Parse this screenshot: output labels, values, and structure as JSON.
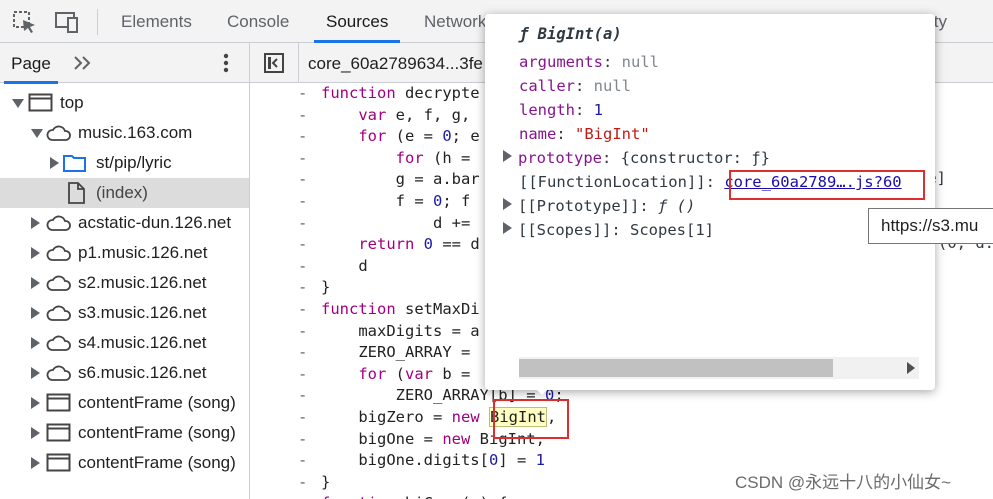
{
  "toolbar": {
    "tabs": [
      {
        "label": "Elements"
      },
      {
        "label": "Console"
      },
      {
        "label": "Sources"
      },
      {
        "label": "Network"
      },
      {
        "label": "ity"
      }
    ],
    "active_tab": "Sources"
  },
  "sidebar": {
    "tab_label": "Page",
    "tree": [
      {
        "label": "top",
        "icon": "frame-icon"
      },
      {
        "label": "music.163.com",
        "icon": "cloud-icon"
      },
      {
        "label": "st/pip/lyric",
        "icon": "folder-icon"
      },
      {
        "label": "(index)",
        "icon": "file-icon"
      },
      {
        "label": "acstatic-dun.126.net",
        "icon": "cloud-icon"
      },
      {
        "label": "p1.music.126.net",
        "icon": "cloud-icon"
      },
      {
        "label": "s2.music.126.net",
        "icon": "cloud-icon"
      },
      {
        "label": "s3.music.126.net",
        "icon": "cloud-icon"
      },
      {
        "label": "s4.music.126.net",
        "icon": "cloud-icon"
      },
      {
        "label": "s6.music.126.net",
        "icon": "cloud-icon"
      },
      {
        "label": "contentFrame (song)",
        "icon": "frame-icon"
      },
      {
        "label": "contentFrame (song)",
        "icon": "frame-icon"
      },
      {
        "label": "contentFrame (song)",
        "icon": "frame-icon"
      }
    ]
  },
  "editor": {
    "file_tab": "core_60a2789634...3fe",
    "lines": [
      {
        "gutter": "-",
        "text": "function decrypte"
      },
      {
        "gutter": "-",
        "text": "    var e, f, g,"
      },
      {
        "gutter": "-",
        "text": "    for (e = 0; e"
      },
      {
        "gutter": "-",
        "text": "        for (h ="
      },
      {
        "gutter": "-",
        "text": "        g = a.bar"
      },
      {
        "gutter": "-",
        "text": "        f = 0; f"
      },
      {
        "gutter": "-",
        "text": "            d +="
      },
      {
        "gutter": "-",
        "text": "    return 0 == d"
      },
      {
        "gutter": "-",
        "text": "    d"
      },
      {
        "gutter": "-",
        "text": "}"
      },
      {
        "gutter": "-",
        "text": "function setMaxDi"
      },
      {
        "gutter": "-",
        "text": "    maxDigits = a"
      },
      {
        "gutter": "-",
        "text": "    ZERO_ARRAY ="
      },
      {
        "gutter": "-",
        "text": "    for (var b ="
      },
      {
        "gutter": "-",
        "text": "        ZERO_ARRAY[b] = 0;"
      },
      {
        "gutter": "-",
        "text": "    bigZero = new BigInt,"
      },
      {
        "gutter": "-",
        "text": "    bigOne = new BigInt,"
      },
      {
        "gutter": "-",
        "text": "    bigOne.digits[0] = 1"
      },
      {
        "gutter": "-",
        "text": "}"
      },
      {
        "gutter": "-",
        "text": "function biCopy(a) {"
      }
    ],
    "right_fragments": [
      {
        "text": "g(c[e]"
      },
      {
        "text": "(0, d."
      }
    ],
    "highlighted_word": "BigInt"
  },
  "popover": {
    "title": "ƒ BigInt(a)",
    "rows": [
      {
        "key": "arguments",
        "value": "null"
      },
      {
        "key": "caller",
        "value": "null"
      },
      {
        "key": "length",
        "value": "1"
      },
      {
        "key": "name",
        "value": "\"BigInt\""
      },
      {
        "key": "prototype",
        "value": "{constructor: ƒ}"
      },
      {
        "key": "[[FunctionLocation]]",
        "value": "core_60a2789….js?60"
      },
      {
        "key": "[[Prototype]]",
        "value": "ƒ ()"
      },
      {
        "key": "[[Scopes]]",
        "value": "Scopes[1]"
      }
    ]
  },
  "tooltip": "https://s3.mu",
  "watermark": "CSDN @永远十八的小仙女~",
  "colors": {
    "accent": "#1a73e8",
    "highlight_box": "#e02e2e",
    "keyword": "#a1007f",
    "property_key": "#881391",
    "string": "#c41a16",
    "number": "#1a1aa6"
  }
}
